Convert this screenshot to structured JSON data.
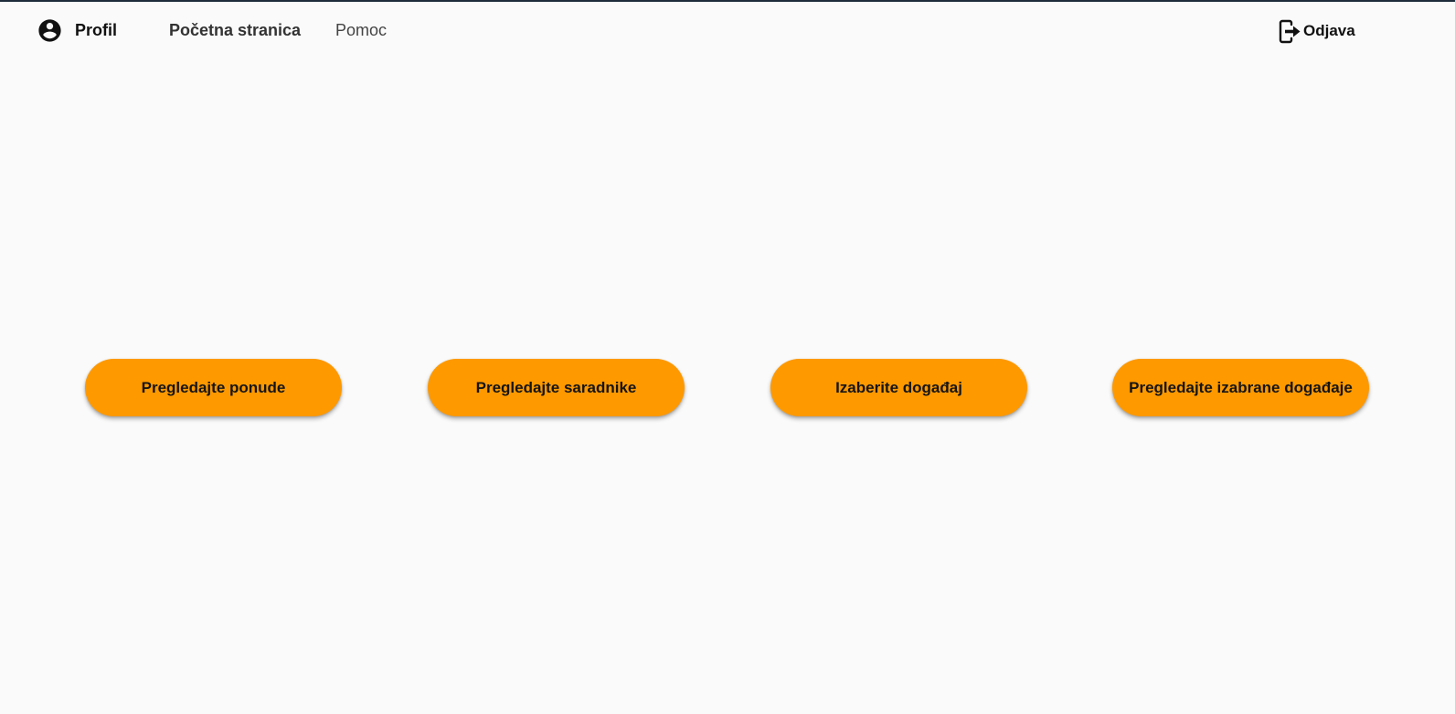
{
  "navbar": {
    "profile_label": "Profil",
    "home_label": "Početna stranica",
    "help_label": "Pomoc",
    "logout_label": "Odjava",
    "profile_icon": "account-circle-icon",
    "logout_icon": "logout-icon"
  },
  "actions": {
    "offers_label": "Pregledajte ponude",
    "collaborators_label": "Pregledajte saradnike",
    "choose_event_label": "Izaberite događaj",
    "chosen_events_label": "Pregledajte izabrane događaje"
  },
  "colors": {
    "accent": "#fe9900",
    "background": "#fafafa",
    "top_border": "#1d2b3a"
  }
}
